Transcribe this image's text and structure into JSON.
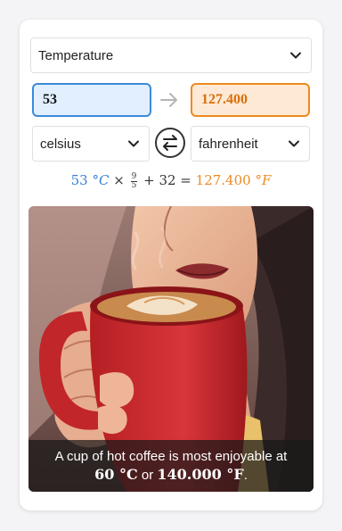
{
  "converter": {
    "category": "Temperature",
    "input_value": "53",
    "output_value": "127.400",
    "from_unit": "celsius",
    "to_unit": "fahrenheit"
  },
  "formula": {
    "input_number": "53",
    "input_unit_symbol": "°C",
    "times": "×",
    "frac_num": "9",
    "frac_den": "5",
    "plus_term": "+ 32 =",
    "output_number": "127.400",
    "output_unit_symbol": "°F"
  },
  "caption": {
    "line1": "A cup of hot coffee is most enjoyable at",
    "value_c": "60 °C",
    "or_word": "or",
    "value_f": "140.000 °F",
    "period": "."
  },
  "colors": {
    "input_border": "#3b8ad9",
    "input_bg": "#e1efff",
    "output_border": "#ee8a1f",
    "output_bg": "#fde9d6",
    "output_text": "#d86f08"
  },
  "icons": {
    "arrow": "arrow-right-icon",
    "swap": "swap-icon",
    "chevron": "chevron-down-icon"
  }
}
